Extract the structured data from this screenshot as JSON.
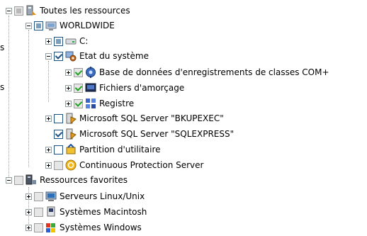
{
  "tree": {
    "root": {
      "label": "Toutes les ressources",
      "icon": "all-resources-icon"
    },
    "worldwide": {
      "label": "WORLDWIDE",
      "icon": "server-icon"
    },
    "c_drive": {
      "label": "C:",
      "icon": "disk-icon"
    },
    "system_state": {
      "label": "Etat du système",
      "icon": "system-state-icon"
    },
    "com_db": {
      "label": "Base de données d'enregistrements de classes COM+",
      "icon": "database-gear-icon"
    },
    "boot_files": {
      "label": "Fichiers d'amorçage",
      "icon": "boot-files-icon"
    },
    "registry": {
      "label": "Registre",
      "icon": "registry-icon"
    },
    "sql_bkupexec": {
      "label": "Microsoft SQL Server \"BKUPEXEC\"",
      "icon": "sql-server-icon"
    },
    "sql_sqlexpress": {
      "label": "Microsoft SQL Server \"SQLEXPRESS\"",
      "icon": "sql-server-icon"
    },
    "utility_partition": {
      "label": "Partition d'utilitaire",
      "icon": "utility-partition-icon"
    },
    "cps": {
      "label": "Continuous Protection Server",
      "icon": "cps-icon"
    },
    "favorites": {
      "label": "Ressources favorites",
      "icon": "favorite-resources-icon"
    },
    "linux": {
      "label": "Serveurs Linux/Unix",
      "icon": "linux-server-icon"
    },
    "mac": {
      "label": "Systèmes Macintosh",
      "icon": "macintosh-icon"
    },
    "windows": {
      "label": "Systèmes Windows",
      "icon": "windows-icon"
    }
  },
  "side_marks": {
    "m1": "s",
    "m2": "s"
  }
}
